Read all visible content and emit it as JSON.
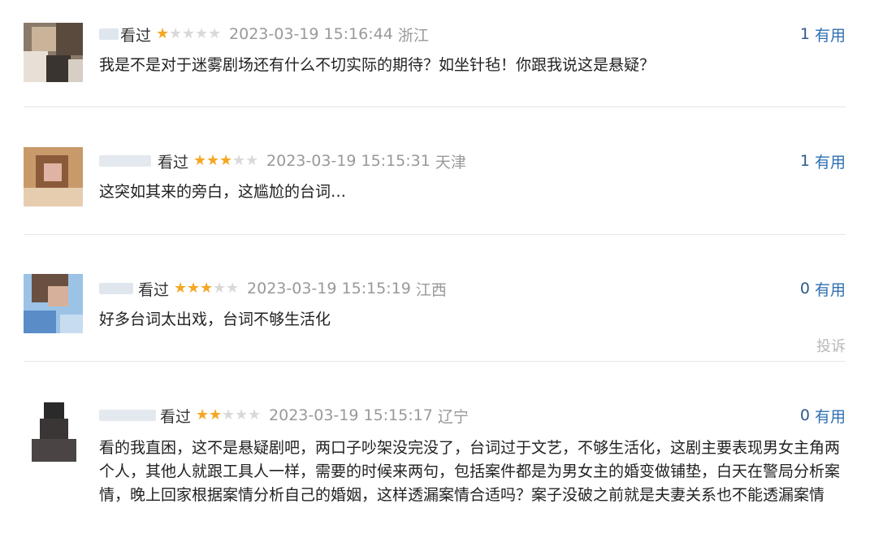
{
  "reviews": [
    {
      "watched": "看过",
      "rating": 1,
      "time": "2023-03-19 15:16:44",
      "location": "浙江",
      "useful_count": "1",
      "useful_label": "有用",
      "content": "我是不是对于迷雾剧场还有什么不切实际的期待？如坐针毡！你跟我说这是悬疑？"
    },
    {
      "watched": "看过",
      "rating": 3,
      "time": "2023-03-19 15:15:31",
      "location": "天津",
      "useful_count": "1",
      "useful_label": "有用",
      "content": "这突如其来的旁白，这尴尬的台词…"
    },
    {
      "watched": "看过",
      "rating": 3,
      "time": "2023-03-19 15:15:19",
      "location": "江西",
      "useful_count": "0",
      "useful_label": "有用",
      "content": "好多台词太出戏，台词不够生活化",
      "report": "投诉"
    },
    {
      "watched": "看过",
      "rating": 2,
      "time": "2023-03-19 15:15:17",
      "location": "辽宁",
      "useful_count": "0",
      "useful_label": "有用",
      "content": "看的我直困，这不是悬疑剧吧，两口子吵架没完没了，台词过于文艺，不够生活化，这剧主要表现男女主角两个人，其他人就跟工具人一样，需要的时候来两句，包括案件都是为男女主的婚变做铺垫，白天在警局分析案情，晚上回家根据案情分析自己的婚姻，这样透漏案情合适吗？案子没破之前就是夫妻关系也不能透漏案情"
    }
  ]
}
